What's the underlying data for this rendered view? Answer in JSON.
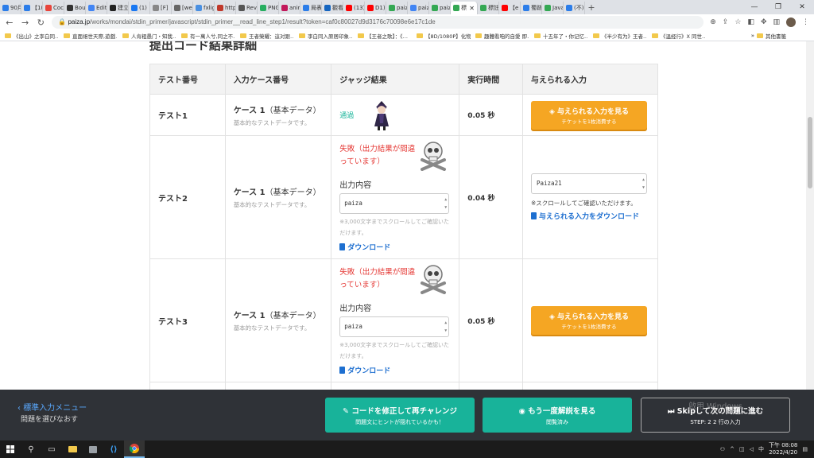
{
  "browser": {
    "tabs": [
      {
        "label": "90月",
        "color": "#2b7de9"
      },
      {
        "label": "【1(",
        "color": "#2b7de9"
      },
      {
        "label": "Coc",
        "color": "#e8453c"
      },
      {
        "label": "Bou",
        "color": "#333333"
      },
      {
        "label": "Edit",
        "color": "#4285f4"
      },
      {
        "label": "建立",
        "color": "#222222"
      },
      {
        "label": "(1)",
        "color": "#1877f2"
      },
      {
        "label": "[F]",
        "color": "#888888"
      },
      {
        "label": "[we",
        "color": "#666666"
      },
      {
        "label": "fxlig",
        "color": "#4a90e2"
      },
      {
        "label": "http",
        "color": "#c0392b"
      },
      {
        "label": "Rev",
        "color": "#555555"
      },
      {
        "label": "PNG",
        "color": "#27ae60"
      },
      {
        "label": "anir",
        "color": "#c2185b"
      },
      {
        "label": "局表",
        "color": "#2b7de9"
      },
      {
        "label": "觀看",
        "color": "#1565c0"
      },
      {
        "label": "(13)",
        "color": "#ff0000"
      },
      {
        "label": "D1)",
        "color": "#ff0000"
      },
      {
        "label": "paiz",
        "color": "#34a853"
      },
      {
        "label": "paiz",
        "color": "#4285f4"
      },
      {
        "label": "paiz",
        "color": "#34a853"
      }
    ],
    "active_tab": {
      "label": "標",
      "color": "#34a853"
    },
    "tabs_after": [
      {
        "label": "標註",
        "color": "#34a853"
      },
      {
        "label": "【e",
        "color": "#ff0000"
      },
      {
        "label": "蜀跡",
        "color": "#2b7de9"
      },
      {
        "label": "Java",
        "color": "#34a853"
      },
      {
        "label": "(不)",
        "color": "#2b7de9"
      }
    ],
    "url_host": "paiza.jp",
    "url_path": "/works/mondai/stdin_primer/javascript/stdin_primer__read_line_step1/result?token=caf0c80027d9d3176c70098e6e17c1de",
    "bookmarks": [
      "《出山》之李白同…",
      "直面絕世天際,遊戲…",
      "人肯粗愚门・知我…",
      "有一萬人兮,同之不…",
      "王者榮耀：這对跟…",
      "李白同入原居印象…",
      "【王者之歌】：《…",
      "【8D/1080P】化物…",
      "趣體看咱的自愛 即…",
      "十五年了・你记忆…",
      "《半少有为》王者…",
      "《温经行》X 同世…"
    ],
    "bookmarks_more": "其他書籤"
  },
  "page": {
    "title": "提出コード結果詳細",
    "columns": [
      "テスト番号",
      "入力ケース番号",
      "ジャッジ結果",
      "実行時間",
      "与えられる入力"
    ],
    "rows": [
      {
        "test": "テスト1",
        "case": "ケース 1",
        "case_tag": "（基本データ）",
        "case_desc": "基本的なテストデータです。",
        "result": "通過",
        "time": "0.05 秒",
        "button_main": "与えられる入力を見る",
        "button_sub": "チケットを1枚消費する"
      },
      {
        "test": "テスト2",
        "case": "ケース 1",
        "case_tag": "（基本データ）",
        "case_desc": "基本的なテストデータです。",
        "result": "失敗（出力結果が間違っています）",
        "output_label": "出力内容",
        "output_value": "paiza",
        "scroll_note": "※3,000文字までスクロールしてご確認いただけます。",
        "download": "ダウンロード",
        "time": "0.04 秒",
        "given_value": "Paiza21",
        "given_note": "※スクロールしてご確認いただけます。",
        "given_download": "与えられる入力をダウンロード"
      },
      {
        "test": "テスト3",
        "case": "ケース 1",
        "case_tag": "（基本データ）",
        "case_desc": "基本的なテストデータです。",
        "result": "失敗（出力結果が間違っています）",
        "output_label": "出力内容",
        "output_value": "paiza",
        "scroll_note": "※3,000文字までスクロールしてご確認いただけます。",
        "download": "ダウンロード",
        "time": "0.05 秒",
        "button_main": "与えられる入力を見る",
        "button_sub": "チケットを1枚消費する"
      }
    ]
  },
  "footer": {
    "menu_link": "標準入力メニュー",
    "menu_sub": "問題を選びなおす",
    "retry_main": "コードを修正して再チャレンジ",
    "retry_sub": "問題文にヒントが隠れているかも！",
    "review_main": "もう一度解説を見る",
    "review_sub": "閲覧済み",
    "skip_main": "Skipして次の問題に進む",
    "skip_sub": "STEP: 2 2 行の入力",
    "watermark": "啟用 Windows"
  },
  "taskbar": {
    "time": "下午 08:08",
    "date": "2022/4/20"
  },
  "colors": {
    "pass": "#19b49a",
    "fail": "#e53935",
    "orange": "#f5a623",
    "teal": "#18b39a",
    "link": "#1e6fd0"
  }
}
